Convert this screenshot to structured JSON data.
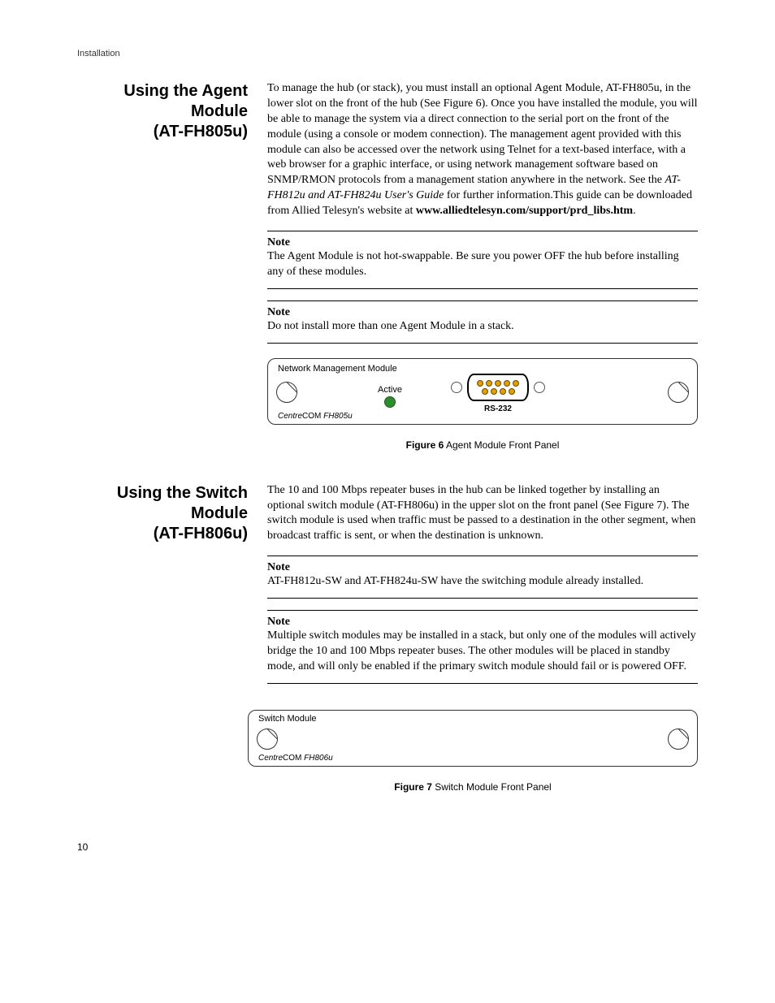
{
  "running_head": "Installation",
  "page_number": "10",
  "section1": {
    "heading_l1": "Using the Agent",
    "heading_l2": "Module",
    "heading_l3": "(AT-FH805u)",
    "para1_a": "To manage the hub (or stack), you must install an optional Agent Module, AT-FH805u, in the lower slot on the front of the hub (See Figure 6). Once you have installed the module, you will be able to manage the system via a direct connection to the serial port on the front of the module (using a console or modem connection). The management agent provided with this module can also be accessed over the network using Telnet for a text-based interface, with a web browser for a graphic interface, or using network management software based on SNMP/RMON protocols from a management station anywhere in the network. See the ",
    "para1_italic": "AT-FH812u and AT-FH824u User's Guide",
    "para1_b": " for further information.This guide can be downloaded from Allied Telesyn's website at ",
    "para1_bold": "www.alliedtelesyn.com/support/prd_libs.htm",
    "para1_c": ".",
    "note1_title": "Note",
    "note1_text": "The Agent Module is not hot-swappable. Be sure you power OFF the hub before installing any of these modules.",
    "note2_title": "Note",
    "note2_text": "Do not install more than one Agent Module in a stack."
  },
  "figure6": {
    "nm_label": "Network Management Module",
    "active_label": "Active",
    "rs232_label": "RS-232",
    "brand_prefix": "Centre",
    "brand_mid": "COM ",
    "brand_model": "FH805u",
    "caption_label": "Figure 6",
    "caption_text": " Agent Module Front Panel"
  },
  "section2": {
    "heading_l1": "Using the Switch",
    "heading_l2": "Module",
    "heading_l3": "(AT-FH806u)",
    "para1": "The 10 and 100 Mbps repeater buses in the hub can be linked together by installing an optional switch module (AT-FH806u) in the upper slot on the front panel (See Figure 7). The switch module is used when traffic must be passed to a destination in the other segment, when broadcast traffic is sent, or when the destination is unknown.",
    "note1_title": "Note",
    "note1_text": "AT-FH812u-SW and AT-FH824u-SW have the switching module already installed.",
    "note2_title": "Note",
    "note2_text": "Multiple switch modules may be installed in a stack, but only one of the modules will actively bridge the 10 and 100 Mbps repeater buses. The other modules will be placed in standby mode, and will only be enabled if the primary switch module should fail or is powered OFF."
  },
  "figure7": {
    "sw_label": "Switch Module",
    "brand_prefix": "Centre",
    "brand_mid": "COM ",
    "brand_model": "FH806u",
    "caption_label": "Figure 7",
    "caption_text": " Switch Module Front Panel"
  }
}
